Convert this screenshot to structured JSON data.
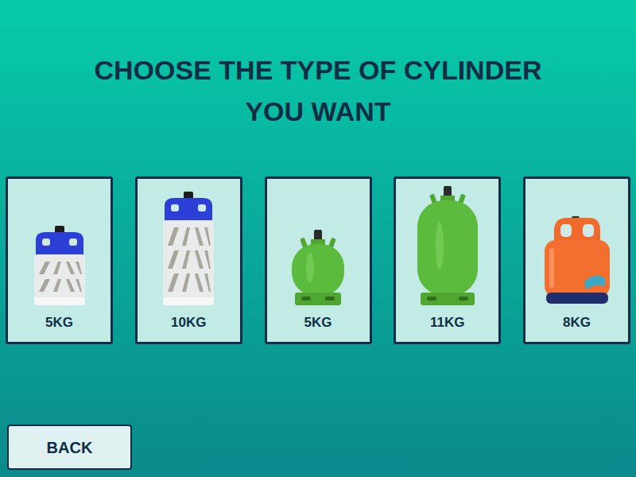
{
  "title_lines": [
    "CHOOSE THE TYPE OF CYLINDER",
    "YOU WANT"
  ],
  "cylinders": [
    {
      "label": "5KG",
      "kind": "composite-small"
    },
    {
      "label": "10KG",
      "kind": "composite-large"
    },
    {
      "label": "5KG",
      "kind": "steel-small"
    },
    {
      "label": "11KG",
      "kind": "steel-large"
    },
    {
      "label": "8KG",
      "kind": "plastic-orange"
    }
  ],
  "back_button": "BACK"
}
